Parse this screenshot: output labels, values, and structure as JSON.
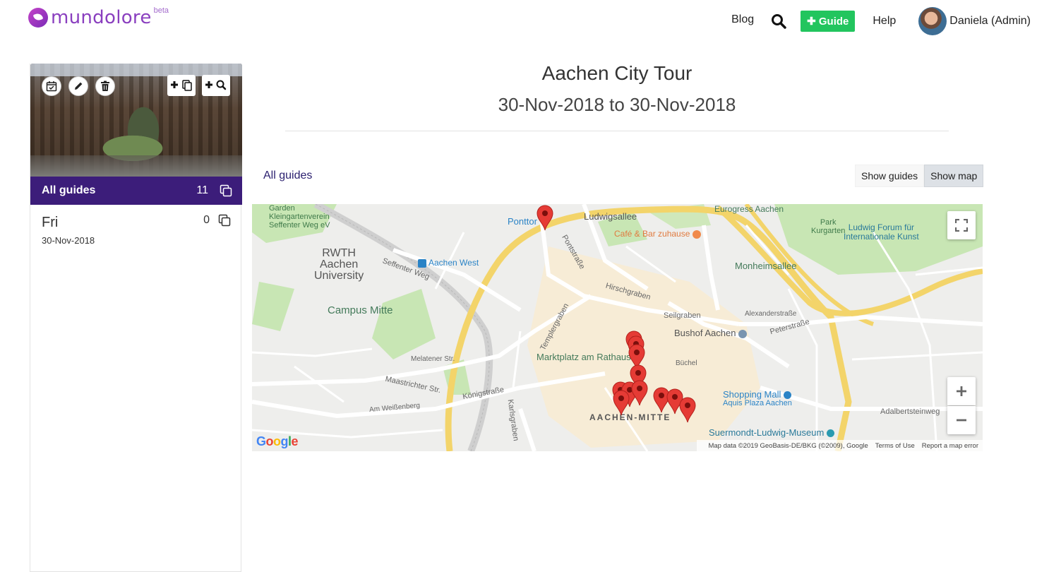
{
  "header": {
    "logo_text": "mundolore",
    "logo_beta": "beta",
    "nav": {
      "blog": "Blog",
      "add_guide": "✚ Guide",
      "help": "Help",
      "user_name": "Daniela (Admin)"
    }
  },
  "sidebar": {
    "all_guides_label": "All guides",
    "all_guides_count": "11",
    "days": [
      {
        "name": "Fri",
        "count": "0",
        "date": "30-Nov-2018"
      }
    ]
  },
  "main": {
    "title": "Aachen City Tour",
    "dates": "30-Nov-2018 to 30-Nov-2018",
    "breadcrumb": "All guides",
    "toggle": {
      "show_guides": "Show guides",
      "show_map": "Show map",
      "active": "show_map"
    }
  },
  "map": {
    "labels": {
      "rwth": "RWTH\nAachen\nUniversity",
      "campus": "Campus Mitte",
      "aachen_west": "Aachen West",
      "ponttor": "Ponttor",
      "ludwigsallee": "Ludwigsallee",
      "cafe": "Café & Bar zuhause",
      "park": "Park\nKurgarten",
      "ludwig_forum": "Ludwig Forum für\nInternationale Kunst",
      "monheimsallee": "Monheimsallee",
      "bushof": "Bushof Aachen",
      "marktplatz": "Marktplatz am Rathaus",
      "aachen_mitte": "AACHEN-MITTE",
      "shopping": "Shopping Mall",
      "aquis": "Aquis Plaza Aachen",
      "suermondt": "Suermondt-Ludwig-Museum",
      "eurogress": "Eurogress Aachen",
      "kleingarten": "Garden\nKleingartenverein\nSeffenter Weg eV",
      "seffenter": "Seffenter Weg",
      "pontstrasse": "Pontstraße",
      "hirschgraben": "Hirschgraben",
      "seilgraben": "Seilgraben",
      "templergraben": "Templergraben",
      "konigstrasse": "Königstraße",
      "maastrichter": "Maastrichter Str.",
      "peterstrasse": "Peterstraße",
      "adalbertsteinweg": "Adalbertsteinweg",
      "karlsgraben": "Karlsgraben",
      "melatener": "Melatener Str.",
      "am_weissenberg": "Am Weißenberg",
      "alexanderstrasse": "Alexanderstraße",
      "buchel": "Büchel"
    },
    "footer": {
      "data": "Map data ©2019 GeoBasis-DE/BKG (©2009), Google",
      "terms": "Terms of Use",
      "report": "Report a map error"
    },
    "google_logo": "Google",
    "markers_count": 11
  }
}
